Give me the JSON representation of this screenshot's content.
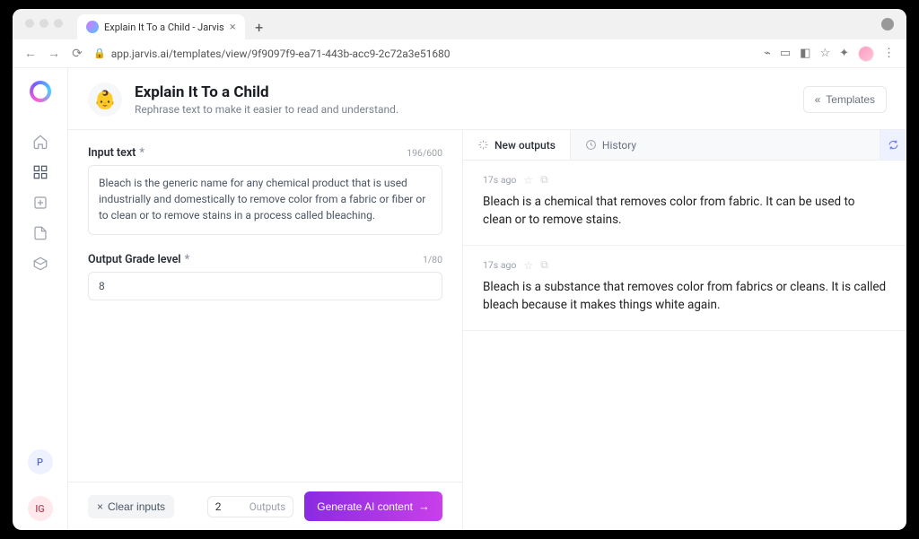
{
  "browser": {
    "tab_title": "Explain It To a Child - Jarvis",
    "url": "app.jarvis.ai/templates/view/9f9097f9-ea71-443b-acc9-2c72a3e51680"
  },
  "sidebar": {
    "avatars": [
      {
        "text": "P"
      },
      {
        "text": "IG"
      }
    ]
  },
  "header": {
    "emoji": "👶",
    "title": "Explain It To a Child",
    "subtitle": "Rephrase text to make it easier to read and understand.",
    "templates_label": "Templates"
  },
  "form": {
    "input_text_label": "Input text",
    "input_text_counter": "196/600",
    "input_text_value": "Bleach is the generic name for any chemical product that is used industrially and domestically to remove color from a fabric or fiber or to clean or to remove stains in a process called bleaching.",
    "grade_label": "Output Grade level",
    "grade_counter": "1/80",
    "grade_value": "8",
    "clear_label": "Clear inputs",
    "outputs_value": "2",
    "outputs_label": "Outputs",
    "generate_label": "Generate AI content"
  },
  "output_tabs": {
    "new_label": "New outputs",
    "history_label": "History"
  },
  "results": [
    {
      "age": "17s ago",
      "text": "Bleach is a chemical that removes color from fabric. It can be used to clean or to remove stains."
    },
    {
      "age": "17s ago",
      "text": "Bleach is a substance that removes color from fabrics or cleans. It is called bleach because it makes things white again."
    }
  ]
}
